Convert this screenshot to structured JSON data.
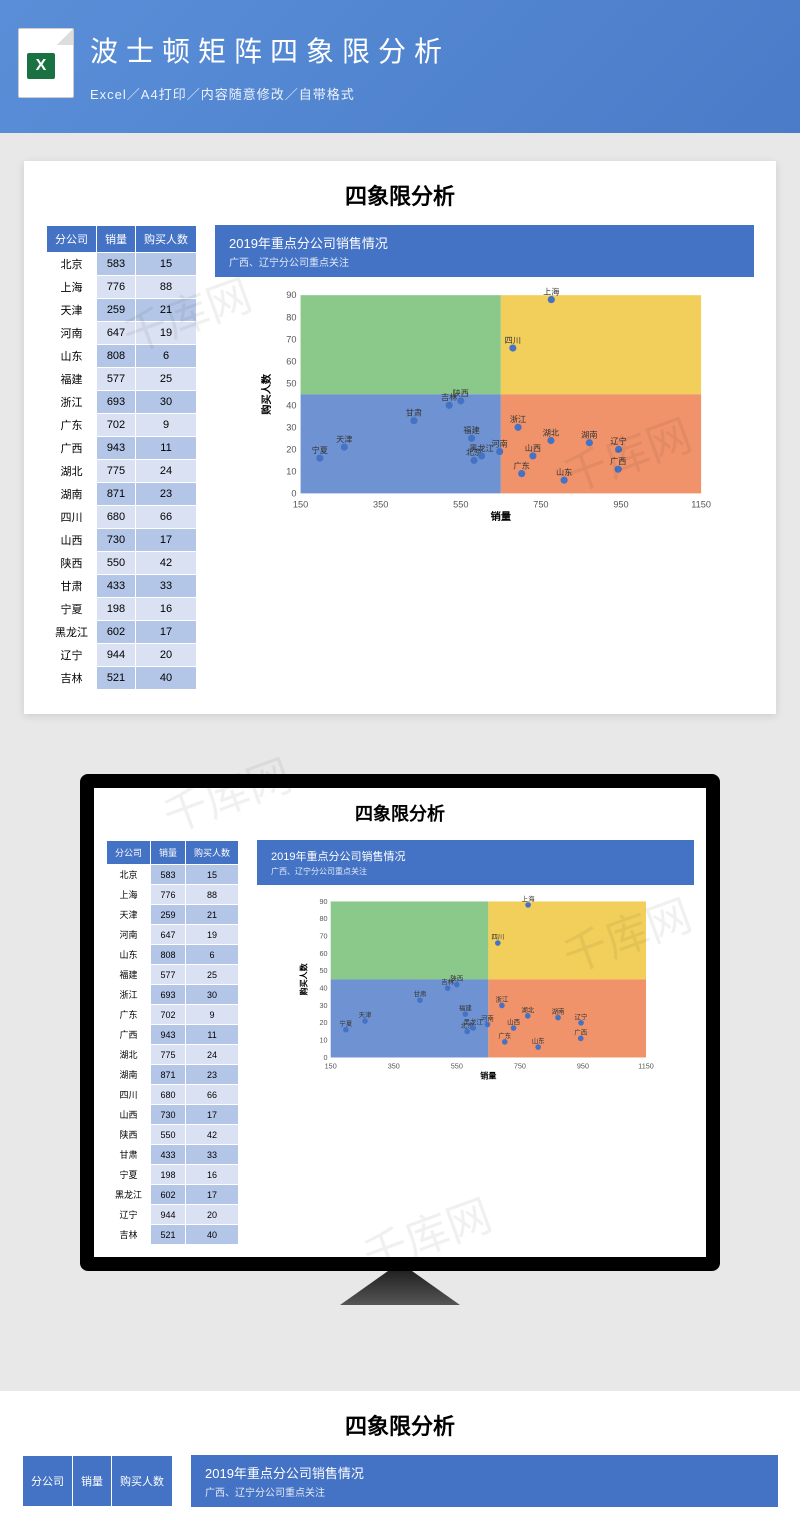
{
  "hero": {
    "title": "波士顿矩阵四象限分析",
    "subtitle": "Excel／A4打印／内容随意修改／自带格式"
  },
  "card_title": "四象限分析",
  "table": {
    "headers": [
      "分公司",
      "销量",
      "购买人数"
    ],
    "rows": [
      [
        "北京",
        583,
        15
      ],
      [
        "上海",
        776,
        88
      ],
      [
        "天津",
        259,
        21
      ],
      [
        "河南",
        647,
        19
      ],
      [
        "山东",
        808,
        6
      ],
      [
        "福建",
        577,
        25
      ],
      [
        "浙江",
        693,
        30
      ],
      [
        "广东",
        702,
        9
      ],
      [
        "广西",
        943,
        11
      ],
      [
        "湖北",
        775,
        24
      ],
      [
        "湖南",
        871,
        23
      ],
      [
        "四川",
        680,
        66
      ],
      [
        "山西",
        730,
        17
      ],
      [
        "陕西",
        550,
        42
      ],
      [
        "甘肃",
        433,
        33
      ],
      [
        "宁夏",
        198,
        16
      ],
      [
        "黑龙江",
        602,
        17
      ],
      [
        "辽宁",
        944,
        20
      ],
      [
        "吉林",
        521,
        40
      ]
    ]
  },
  "chart_head": {
    "title": "2019年重点分公司销售情况",
    "subtitle": "广西、辽宁分公司重点关注"
  },
  "chart_data": {
    "type": "scatter",
    "title": "四象限分析",
    "xlabel": "销量",
    "ylabel": "购买人数",
    "xlim": [
      150,
      1150
    ],
    "ylim": [
      0,
      90
    ],
    "x_ticks": [
      150,
      350,
      550,
      750,
      950,
      1150
    ],
    "y_ticks": [
      0,
      10,
      20,
      30,
      40,
      50,
      60,
      70,
      80,
      90
    ],
    "x_split": 650,
    "y_split": 45,
    "quadrant_colors": {
      "tl": "#8bc98b",
      "tr": "#f2cf5b",
      "bl": "#6f93d2",
      "br": "#f0936a"
    },
    "series": [
      {
        "name": "分公司",
        "points": [
          {
            "label": "北京",
            "x": 583,
            "y": 15
          },
          {
            "label": "上海",
            "x": 776,
            "y": 88
          },
          {
            "label": "天津",
            "x": 259,
            "y": 21
          },
          {
            "label": "河南",
            "x": 647,
            "y": 19
          },
          {
            "label": "山东",
            "x": 808,
            "y": 6
          },
          {
            "label": "福建",
            "x": 577,
            "y": 25
          },
          {
            "label": "浙江",
            "x": 693,
            "y": 30
          },
          {
            "label": "广东",
            "x": 702,
            "y": 9
          },
          {
            "label": "广西",
            "x": 943,
            "y": 11
          },
          {
            "label": "湖北",
            "x": 775,
            "y": 24
          },
          {
            "label": "湖南",
            "x": 871,
            "y": 23
          },
          {
            "label": "四川",
            "x": 680,
            "y": 66
          },
          {
            "label": "山西",
            "x": 730,
            "y": 17
          },
          {
            "label": "陕西",
            "x": 550,
            "y": 42
          },
          {
            "label": "甘肃",
            "x": 433,
            "y": 33
          },
          {
            "label": "宁夏",
            "x": 198,
            "y": 16
          },
          {
            "label": "黑龙江",
            "x": 602,
            "y": 17
          },
          {
            "label": "辽宁",
            "x": 944,
            "y": 20
          },
          {
            "label": "吉林",
            "x": 521,
            "y": 40
          }
        ]
      }
    ]
  },
  "watermark": "千库网"
}
